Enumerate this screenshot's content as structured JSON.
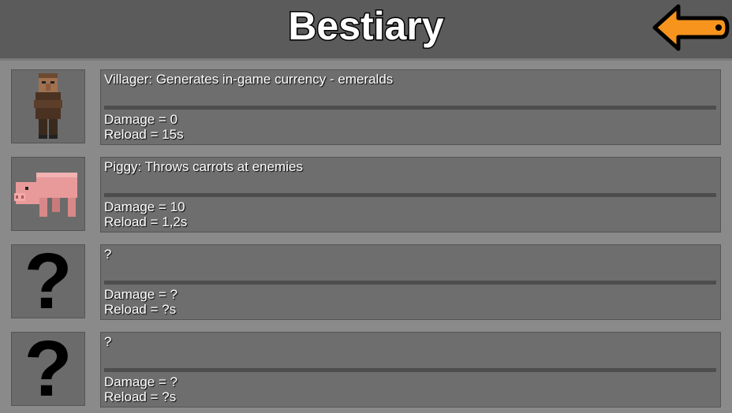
{
  "header": {
    "title": "Bestiary",
    "back_icon": "arrow-left-icon"
  },
  "entries": [
    {
      "icon": "villager-icon",
      "description": "Villager: Generates in-game currency - emeralds",
      "damage": "Damage = 0",
      "reload": "Reload = 15s"
    },
    {
      "icon": "pig-icon",
      "description": "Piggy: Throws carrots at enemies",
      "damage": "Damage = 10",
      "reload": "Reload = 1,2s"
    },
    {
      "icon": "question-mark-icon",
      "icon_text": "?",
      "description": "?",
      "damage": "Damage = ?",
      "reload": "Reload = ?s"
    },
    {
      "icon": "question-mark-icon",
      "icon_text": "?",
      "description": "?",
      "damage": "Damage = ?",
      "reload": "Reload = ?s"
    }
  ],
  "colors": {
    "header_bg": "#5b5b5b",
    "page_bg": "#8a8a8a",
    "panel_bg": "#6e6e6e",
    "back_arrow": "#f7941d"
  }
}
